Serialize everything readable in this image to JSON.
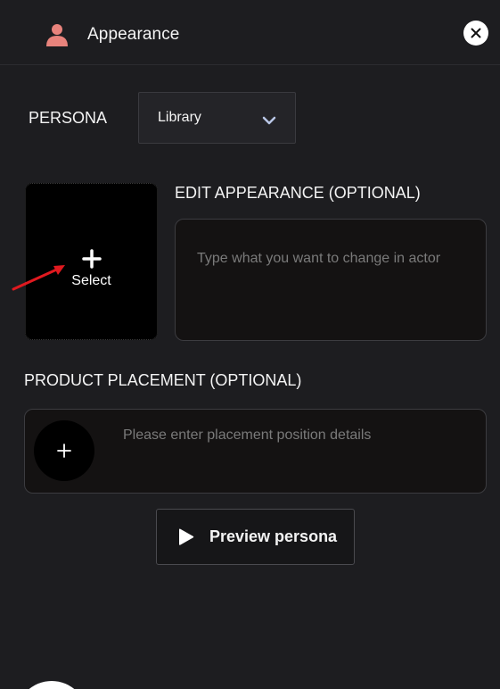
{
  "header": {
    "title": "Appearance",
    "icon": "user-icon",
    "icon_color": "#e8837c"
  },
  "persona": {
    "label": "PERSONA",
    "selected": "Library"
  },
  "image_picker": {
    "label": "Select"
  },
  "edit_appearance": {
    "label": "EDIT APPEARANCE (OPTIONAL)",
    "placeholder": "Type what you want to change in actor"
  },
  "product_placement": {
    "label": "PRODUCT PLACEMENT (OPTIONAL)",
    "placeholder": "Please enter placement position details"
  },
  "preview": {
    "label": "Preview persona"
  },
  "colors": {
    "background": "#1d1d20",
    "annotation_arrow": "#e0191f"
  }
}
